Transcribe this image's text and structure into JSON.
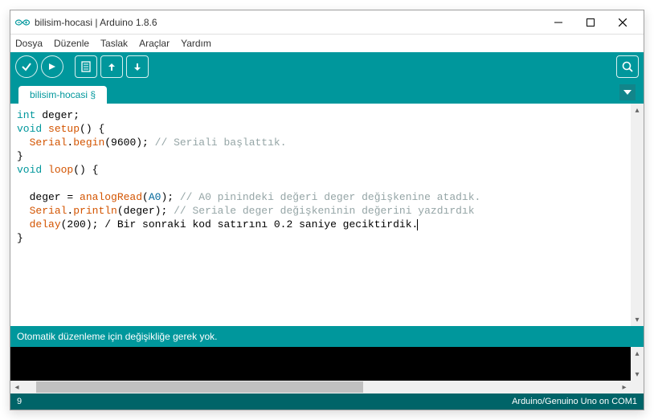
{
  "window": {
    "title": "bilisim-hocasi | Arduino 1.8.6"
  },
  "menubar": {
    "file": "Dosya",
    "edit": "Düzenle",
    "sketch": "Taslak",
    "tools": "Araçlar",
    "help": "Yardım"
  },
  "tab": {
    "name": "bilisim-hocasi §"
  },
  "code": {
    "l1_int": "int",
    "l1_rest": " deger;",
    "l2_void": "void",
    "l2_setup": "setup",
    "l2_rest": "() {",
    "l3_indent": "  ",
    "l3_serial": "Serial",
    "l3_dot": ".",
    "l3_begin": "begin",
    "l3_args": "(9600); ",
    "l3_comment": "// Seriali başlattık.",
    "l4": "}",
    "l5_void": "void",
    "l5_loop": "loop",
    "l5_rest": "() {",
    "l6": "",
    "l7_indent": "  deger = ",
    "l7_analog": "analogRead",
    "l7_open": "(",
    "l7_a0": "A0",
    "l7_close": "); ",
    "l7_comment": "// A0 pinindeki değeri deger değişkenine atadık.",
    "l8_indent": "  ",
    "l8_serial": "Serial",
    "l8_dot": ".",
    "l8_println": "println",
    "l8_args": "(deger); ",
    "l8_comment": "// Seriale deger değişkeninin değerini yazdırdık",
    "l9_indent": "  ",
    "l9_delay": "delay",
    "l9_args": "(200); / Bir sonraki kod satırını 0.2 saniye geciktirdik.",
    "l10": "}"
  },
  "status": {
    "message": "Otomatik düzenleme için değişikliğe gerek yok."
  },
  "footer": {
    "line": "9",
    "board": "Arduino/Genuino Uno on COM1"
  }
}
